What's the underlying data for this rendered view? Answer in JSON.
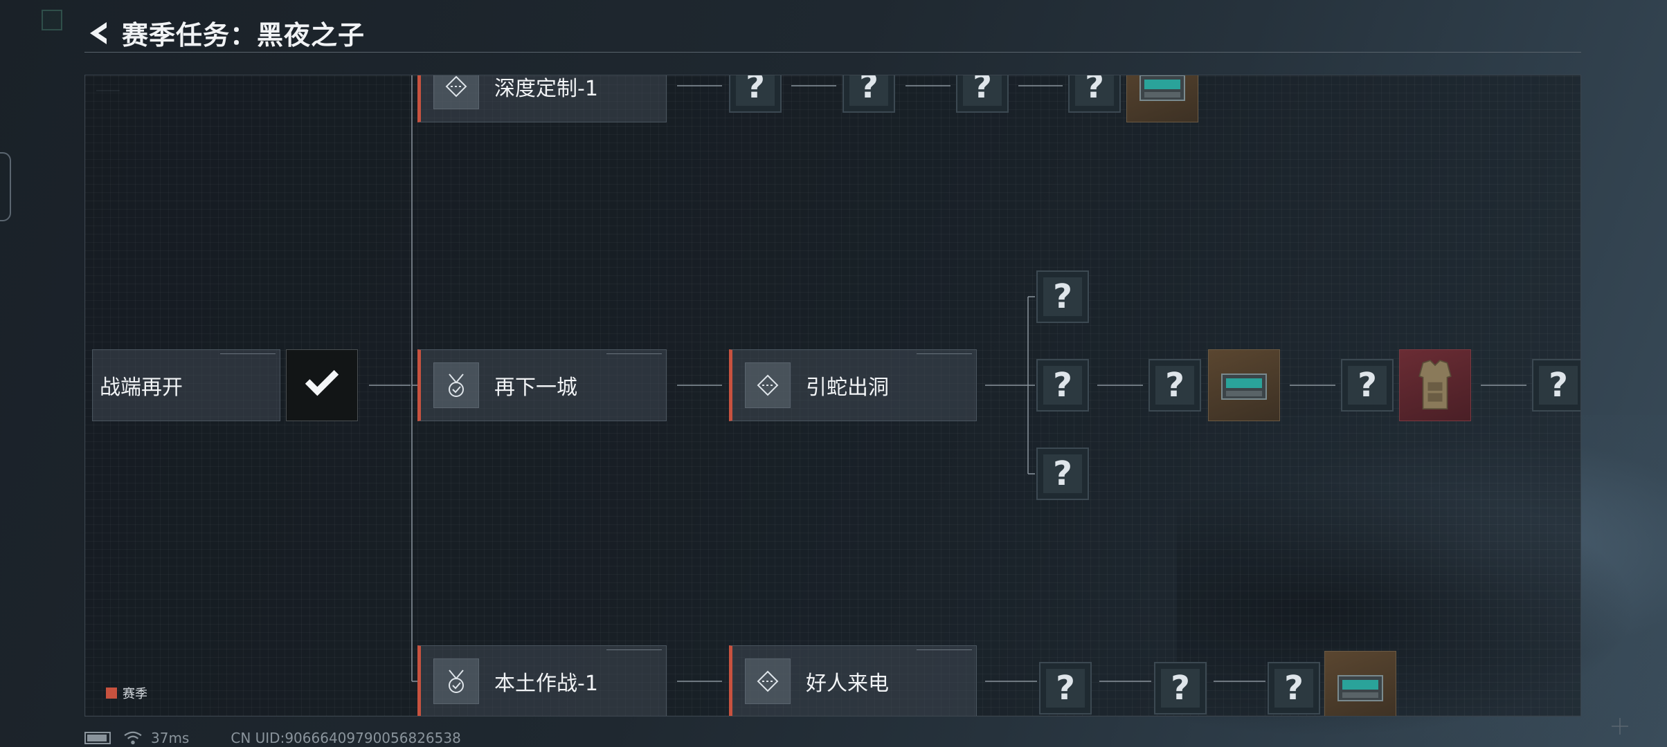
{
  "header": {
    "title": "赛季任务：黑夜之子"
  },
  "nodes": {
    "start": {
      "label": "战端再开"
    },
    "deep": {
      "label": "深度定制-1"
    },
    "city": {
      "label": "再下一城"
    },
    "snake": {
      "label": "引蛇出洞"
    },
    "local": {
      "label": "本土作战-1"
    },
    "call": {
      "label": "好人来电"
    }
  },
  "unknown_symbol": "?",
  "legend": {
    "label": "赛季",
    "color": "#c8523f"
  },
  "status": {
    "ping": "37ms",
    "uid": "CN UID:90666409790056826538"
  },
  "colors": {
    "accent": "#c8523f",
    "background": "#1f2830"
  }
}
